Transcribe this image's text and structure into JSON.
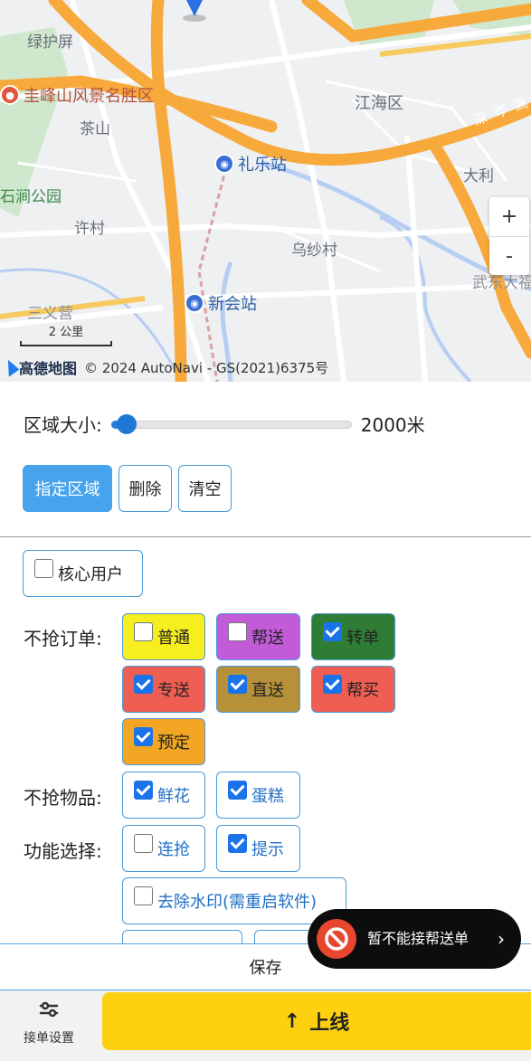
{
  "map": {
    "labels": {
      "lvhupin": "绿护屏",
      "guifeng": "圭峰山风景名胜区",
      "chashan": "茶山",
      "jianghai": "江海区",
      "dongpark": "石涧公园",
      "xucun": "许村",
      "wushacun": "乌纱村",
      "dali": "大利",
      "sanyi": "三义营",
      "wuxin": "武东大福",
      "shencen": "深 岑 高"
    },
    "stations": {
      "lile": "礼乐站",
      "xinhui": "新会站"
    },
    "zoom": {
      "in": "+",
      "out": "-"
    },
    "scale": "2 公里",
    "logo": "高德地图",
    "copyright": "© 2024 AutoNavi - GS(2021)6375号"
  },
  "area": {
    "label": "区域大小:",
    "value_text": "2000米",
    "slider_fraction": 0.04
  },
  "area_buttons": {
    "designate": "指定区域",
    "delete": "删除",
    "clear": "清空"
  },
  "core_user": {
    "label": "核心用户",
    "checked": false
  },
  "no_grab_orders": {
    "label": "不抢订单:",
    "items": [
      {
        "label": "普通",
        "checked": false,
        "bg": "#f7ee1f"
      },
      {
        "label": "帮送",
        "checked": false,
        "bg": "#c15bd8"
      },
      {
        "label": "转单",
        "checked": true,
        "bg": "#2f7d34"
      },
      {
        "label": "专送",
        "checked": true,
        "bg": "#ef5e52"
      },
      {
        "label": "直送",
        "checked": true,
        "bg": "#b6913a"
      },
      {
        "label": "帮买",
        "checked": true,
        "bg": "#ef5e52"
      },
      {
        "label": "预定",
        "checked": true,
        "bg": "#f3a623"
      }
    ]
  },
  "no_grab_items": {
    "label": "不抢物品:",
    "items": [
      {
        "label": "鲜花",
        "checked": true
      },
      {
        "label": "蛋糕",
        "checked": true
      }
    ]
  },
  "features": {
    "label": "功能选择:",
    "items": [
      {
        "label": "连抢",
        "checked": false
      },
      {
        "label": "提示",
        "checked": true
      },
      {
        "label": "去除水印(需重启软件)",
        "checked": false
      }
    ]
  },
  "save": "保存",
  "toast": {
    "message": "暂不能接帮送单",
    "chevron": "›"
  },
  "nav": {
    "settings_label": "接单设置",
    "online_label": "上线",
    "online_icon": "↑"
  },
  "colors": {
    "primary": "#46a3ec",
    "accent_yellow": "#fdd10f",
    "toast_bg": "#0d0d0d",
    "ban_red": "#e8462f"
  }
}
